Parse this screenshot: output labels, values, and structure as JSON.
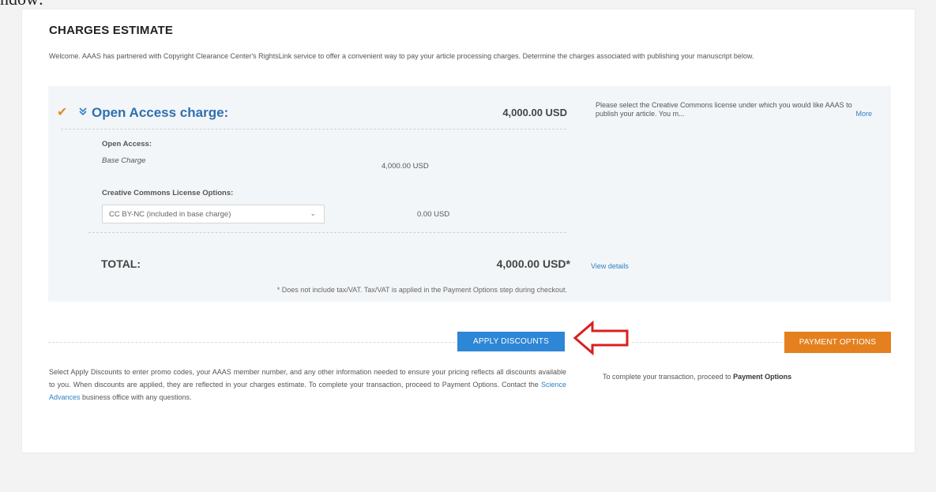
{
  "page": {
    "top_fragment": "ndow:"
  },
  "charges": {
    "title": "CHARGES ESTIMATE",
    "intro": "Welcome. AAAS has partnered with Copyright Clearance Center's RightsLink service to offer a convenient way to pay your article processing charges. Determine the charges associated with publishing your manuscript below."
  },
  "open_access": {
    "title": "Open Access charge:",
    "amount": "4,000.00 USD",
    "note": "Please select the Creative Commons license under which you would like AAAS to publish your article. You m...",
    "more_label": "More",
    "section_label": "Open Access:",
    "base_label": "Base Charge",
    "base_amount": "4,000.00 USD",
    "license_label": "Creative Commons License Options:",
    "license_selected": "CC BY-NC (included in base charge)",
    "license_amount": "0.00 USD"
  },
  "total": {
    "label": "TOTAL:",
    "amount": "4,000.00 USD*",
    "view_details": "View details",
    "tax_note": "* Does not include tax/VAT. Tax/VAT is applied in the Payment Options step during checkout."
  },
  "actions": {
    "apply_discounts": "APPLY DISCOUNTS",
    "payment_options": "PAYMENT OPTIONS"
  },
  "help": {
    "left_part1": "Select Apply Discounts to enter promo codes, your AAAS member number, and any other information needed to ensure your pricing reflects all discounts available to you. When discounts are applied, they are reflected in your charges estimate. To complete your transaction, proceed to Payment Options. Contact the",
    "left_link": "Science Advances",
    "left_part2": "business office with any questions.",
    "right_text": "To complete your transaction, proceed to",
    "right_bold": "Payment Options"
  },
  "colors": {
    "accent_blue": "#2d86d6",
    "accent_orange": "#e4801e",
    "arrow_red": "#d9201f",
    "check_orange": "#e58a2e"
  },
  "icons": {
    "check": "check-icon",
    "chevron": "double-chevron-down-icon",
    "dropdown": "chevron-down-icon",
    "arrow": "left-arrow-icon"
  }
}
